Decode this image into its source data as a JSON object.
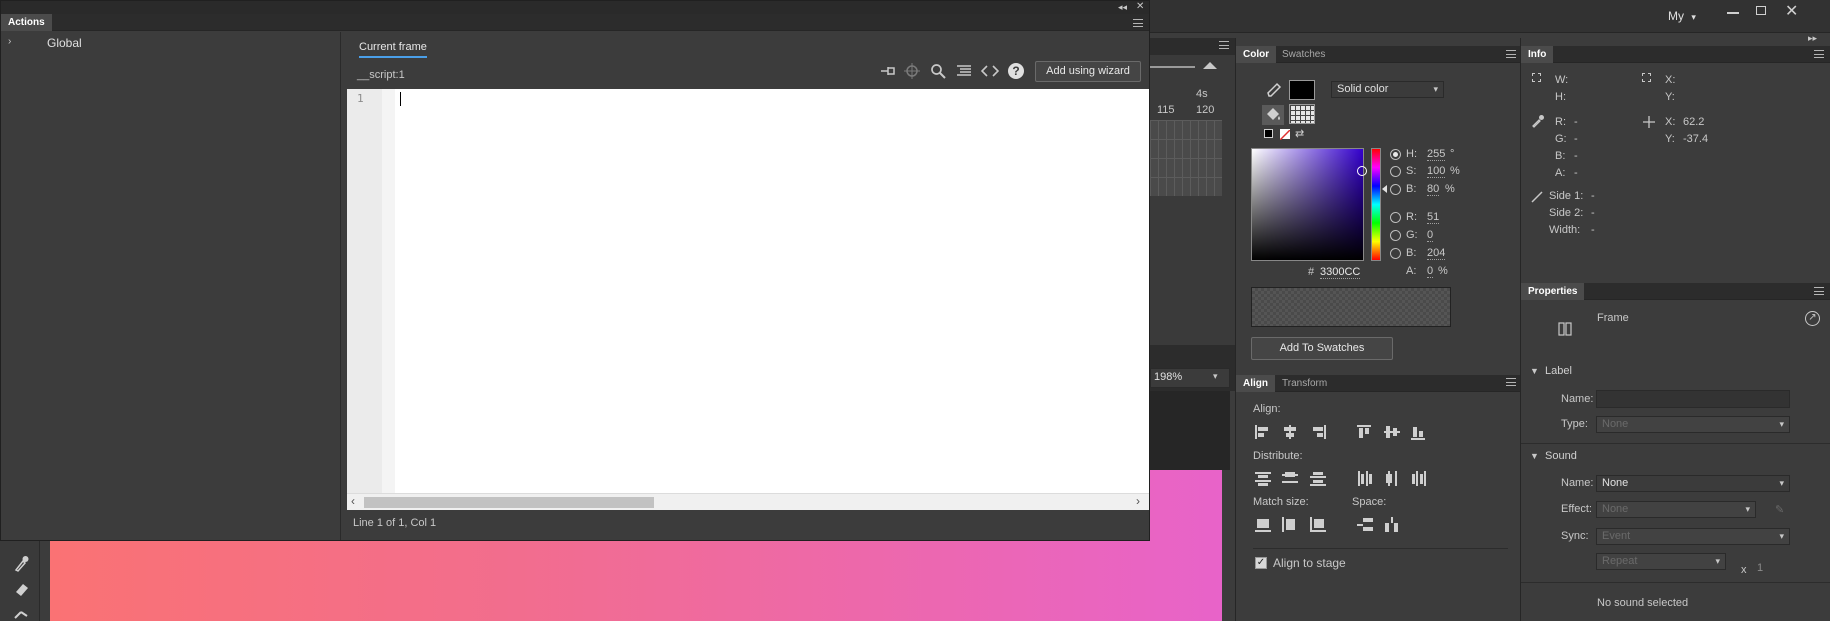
{
  "topbar": {
    "workspace": "My",
    "workspace_arrow": "▾"
  },
  "actions": {
    "title": "Actions",
    "tree_item": "Global",
    "tab_current_frame": "Current frame",
    "script_label": "__script:1",
    "add_wizard": "Add using wizard",
    "line_number": "1",
    "status": "Line 1 of 1, Col 1"
  },
  "timeline": {
    "seconds_label": "4s",
    "frame_labels": [
      "115",
      "120"
    ],
    "zoom": "198%"
  },
  "color": {
    "tab_color": "Color",
    "tab_swatches": "Swatches",
    "fill_type": "Solid color",
    "h_label": "H:",
    "h_value": "255",
    "h_unit": "°",
    "s_label": "S:",
    "s_value": "100",
    "s_unit": "%",
    "b_label": "B:",
    "b_value": "80",
    "b_unit": "%",
    "r_label": "R:",
    "r_value": "51",
    "g_label": "G:",
    "g_value": "0",
    "bl_label": "B:",
    "bl_value": "204",
    "a_label": "A:",
    "a_value": "0",
    "a_unit": "%",
    "hex_label": "#",
    "hex_value": "3300CC",
    "add_swatches": "Add To Swatches",
    "selected_color": "#3300CC"
  },
  "align": {
    "tab_align": "Align",
    "tab_transform": "Transform",
    "align_label": "Align:",
    "distribute_label": "Distribute:",
    "match_size_label": "Match size:",
    "space_label": "Space:",
    "align_to_stage": "Align to stage"
  },
  "info": {
    "title": "Info",
    "w": "W:",
    "h": "H:",
    "x1": "X:",
    "y1": "Y:",
    "r": "R:",
    "r_v": "-",
    "g": "G:",
    "g_v": "-",
    "b": "B:",
    "b_v": "-",
    "a": "A:",
    "a_v": "-",
    "x2": "X:",
    "x2_v": "62.2",
    "y2": "Y:",
    "y2_v": "-37.4",
    "side1": "Side 1:",
    "side1_v": "-",
    "side2": "Side 2:",
    "side2_v": "-",
    "width": "Width:",
    "width_v": "-"
  },
  "properties": {
    "title": "Properties",
    "type": "Frame",
    "label_section": "Label",
    "name_label": "Name:",
    "type_label": "Type:",
    "type_value": "None",
    "sound_section": "Sound",
    "sound_name_label": "Name:",
    "sound_name_value": "None",
    "effect_label": "Effect:",
    "effect_value": "None",
    "sync_label": "Sync:",
    "sync_value": "Event",
    "repeat_value": "Repeat",
    "repeat_x": "x",
    "repeat_count": "1",
    "no_sound": "No sound selected"
  },
  "colors": {
    "stage_gradient_start": "#fa7274",
    "stage_gradient_end": "#e863c9"
  }
}
